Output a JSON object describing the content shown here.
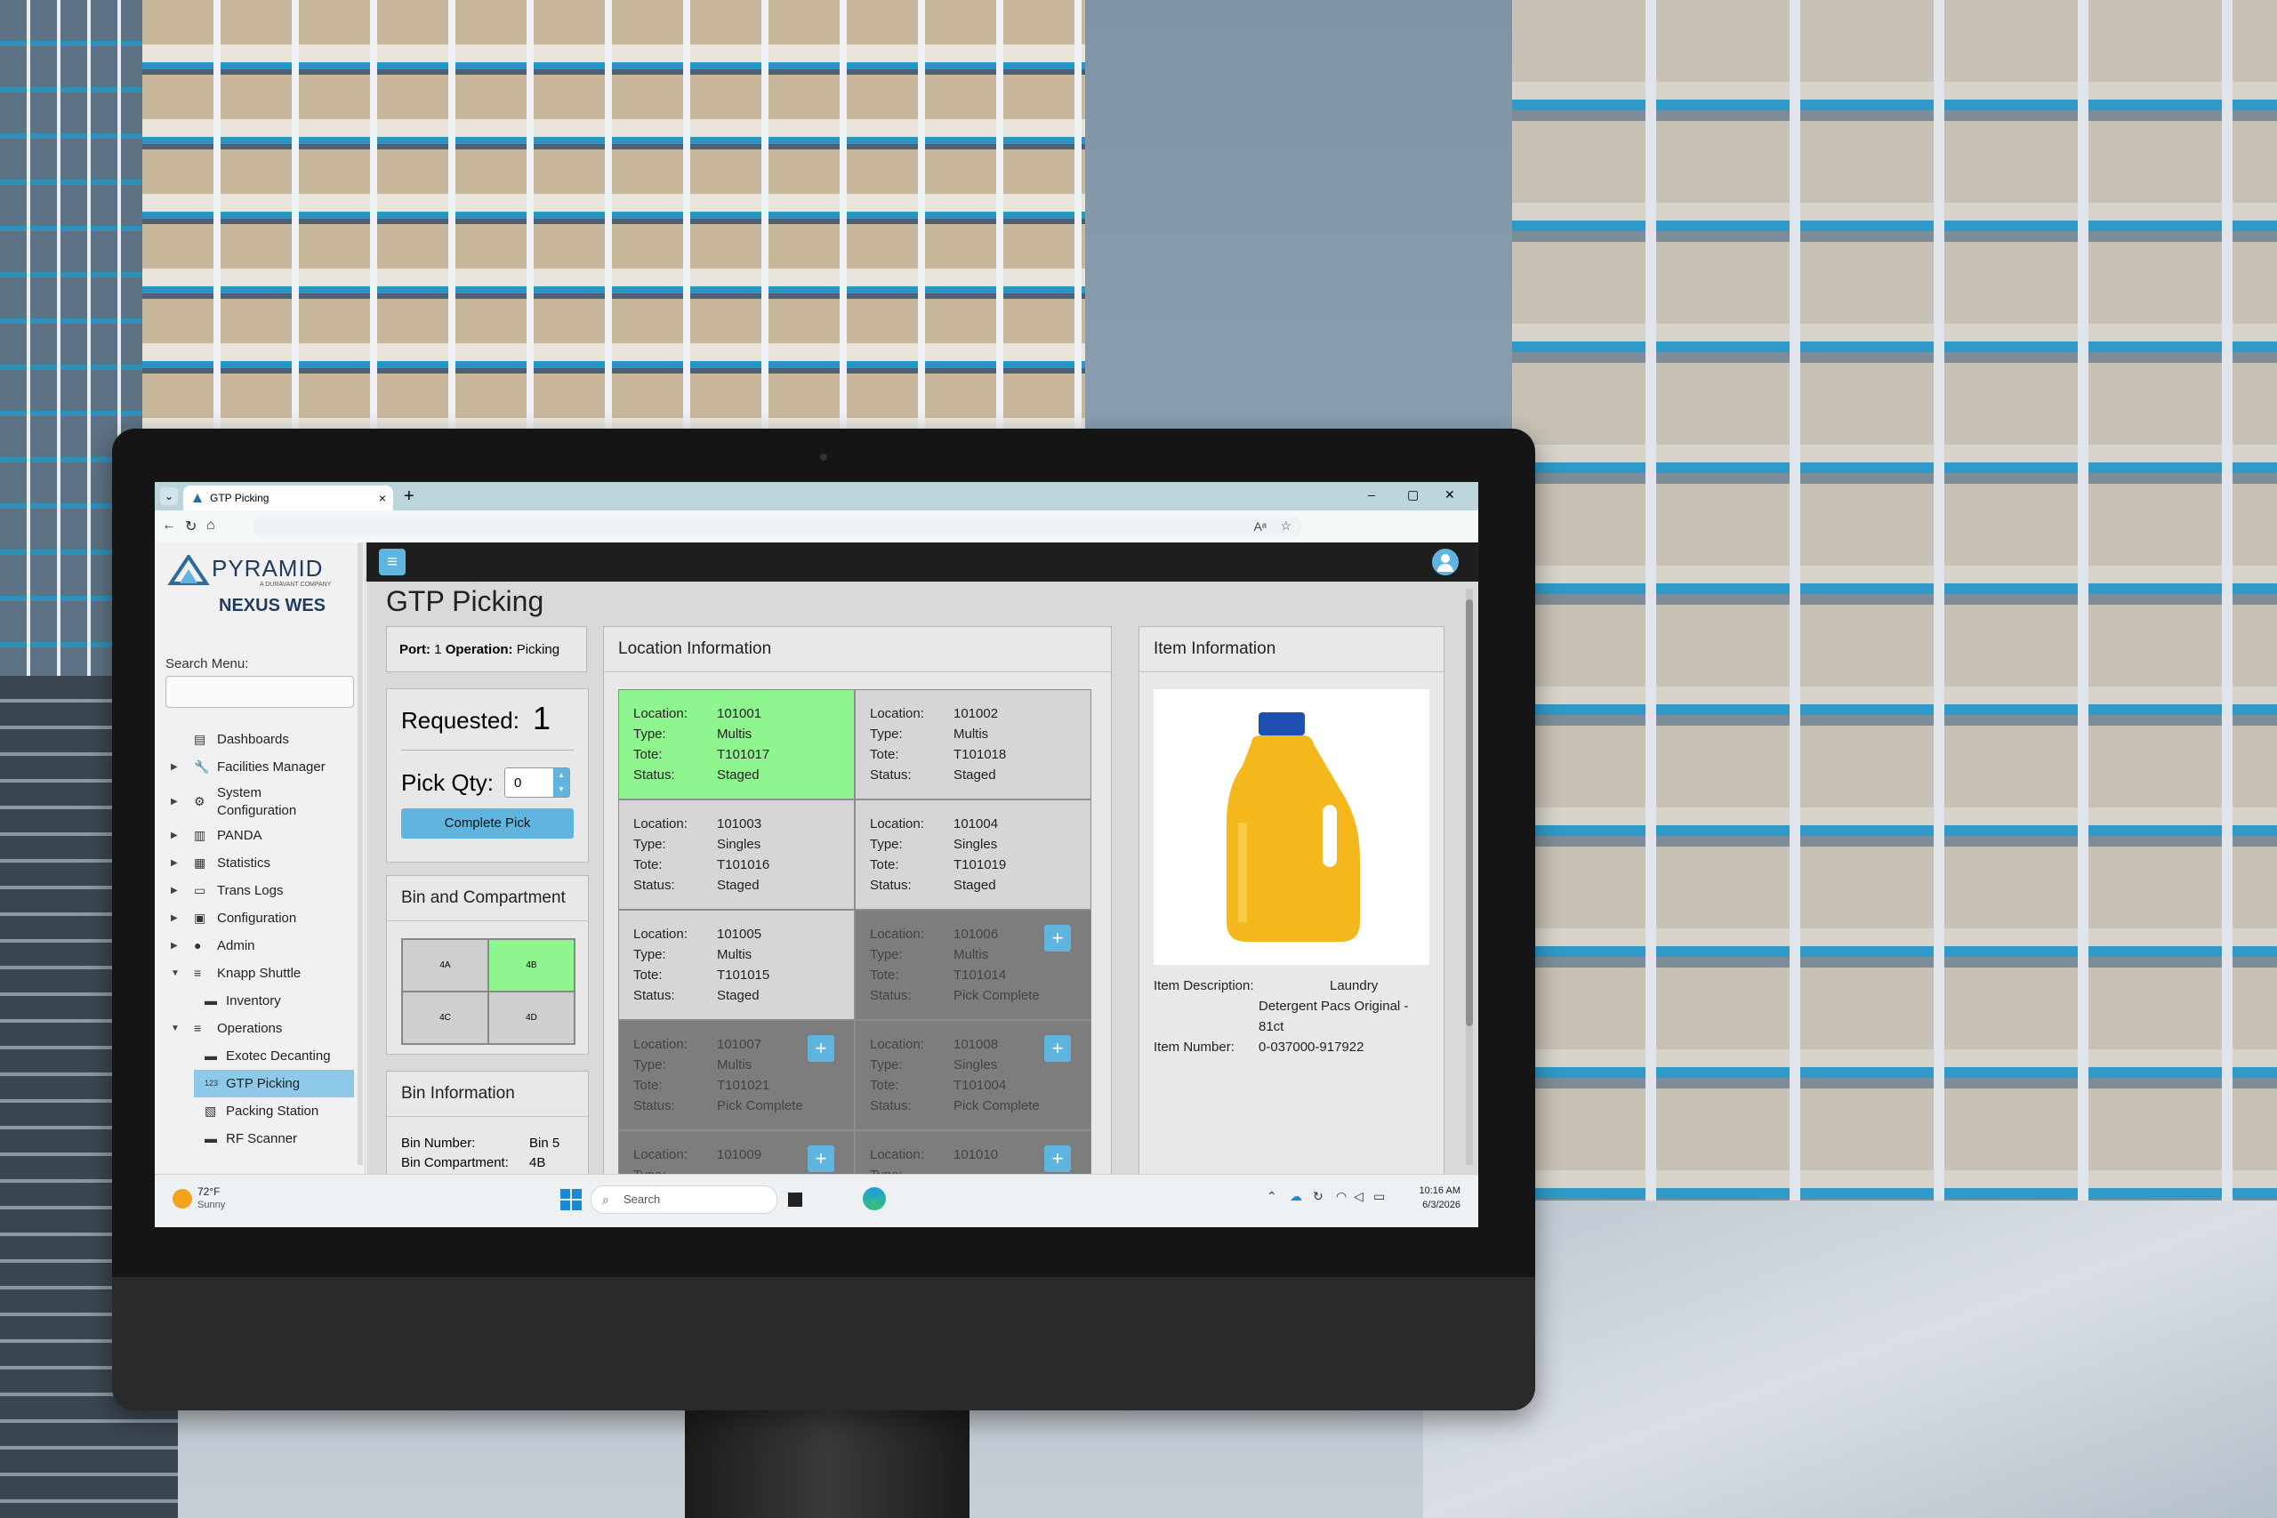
{
  "browser": {
    "tab_title": "GTP Picking",
    "tab_close": "×",
    "new_tab": "+",
    "window_controls": [
      "–",
      "▢",
      "✕"
    ]
  },
  "sidebar": {
    "logo_name": "PYRAMID",
    "logo_sub": "A DURAVANT COMPANY",
    "product": "NEXUS WES",
    "search_label": "Search Menu:",
    "search_placeholder": "",
    "items": [
      {
        "label": "Dashboards",
        "icon": "dashboard-icon",
        "glyph": "▤"
      },
      {
        "label": "Facilities Manager",
        "icon": "wrench-icon",
        "glyph": "🔧"
      },
      {
        "label": "System Configuration",
        "icon": "gears-icon",
        "glyph": "⚙"
      },
      {
        "label": "PANDA",
        "icon": "building-icon",
        "glyph": "▥"
      },
      {
        "label": "Statistics",
        "icon": "chart-icon",
        "glyph": "▦"
      },
      {
        "label": "Trans Logs",
        "icon": "log-icon",
        "glyph": "▭"
      },
      {
        "label": "Configuration",
        "icon": "config-icon",
        "glyph": "▣"
      },
      {
        "label": "Admin",
        "icon": "user-icon",
        "glyph": "●"
      },
      {
        "label": "Knapp Shuttle",
        "icon": "list-icon",
        "glyph": "≡"
      },
      {
        "label": "Inventory",
        "icon": "inventory-icon",
        "glyph": "▬"
      },
      {
        "label": "Operations",
        "icon": "list-icon",
        "glyph": "≡"
      },
      {
        "label": "Exotec Decanting",
        "icon": "decant-icon",
        "glyph": "▬"
      },
      {
        "label": "GTP Picking",
        "icon": "numbers-icon",
        "glyph": "123"
      },
      {
        "label": "Packing Station",
        "icon": "package-icon",
        "glyph": "▧"
      },
      {
        "label": "RF Scanner",
        "icon": "scanner-icon",
        "glyph": "▬"
      }
    ]
  },
  "page": {
    "title": "GTP Picking",
    "port_label": "Port:",
    "port_value": "1",
    "operation_label": "Operation:",
    "operation_value": "Picking",
    "requested_label": "Requested:",
    "requested_value": "1",
    "pick_qty_label": "Pick Qty:",
    "pick_qty_value": "0",
    "complete_button": "Complete Pick",
    "bin_compartment_title": "Bin and Compartment",
    "compartments": [
      {
        "label": "4A",
        "active": false
      },
      {
        "label": "4B",
        "active": true
      },
      {
        "label": "4C",
        "active": false
      },
      {
        "label": "4D",
        "active": false
      }
    ],
    "bin_info_title": "Bin Information",
    "bin_number_label": "Bin Number:",
    "bin_number_value": "Bin 5",
    "bin_compartment_label": "Bin Compartment:",
    "bin_compartment_value": "4B"
  },
  "location_info": {
    "title": "Location Information",
    "field_labels": [
      "Location:",
      "Type:",
      "Tote:",
      "Status:"
    ],
    "locations": [
      {
        "location": "101001",
        "type": "Multis",
        "tote": "T101017",
        "status": "Staged",
        "state": "green"
      },
      {
        "location": "101002",
        "type": "Multis",
        "tote": "T101018",
        "status": "Staged",
        "state": "staged"
      },
      {
        "location": "101003",
        "type": "Singles",
        "tote": "T101016",
        "status": "Staged",
        "state": "staged"
      },
      {
        "location": "101004",
        "type": "Singles",
        "tote": "T101019",
        "status": "Staged",
        "state": "staged"
      },
      {
        "location": "101005",
        "type": "Multis",
        "tote": "T101015",
        "status": "Staged",
        "state": "staged"
      },
      {
        "location": "101006",
        "type": "Multis",
        "tote": "T101014",
        "status": "Pick Complete",
        "state": "done"
      },
      {
        "location": "101007",
        "type": "Multis",
        "tote": "T101021",
        "status": "Pick Complete",
        "state": "done"
      },
      {
        "location": "101008",
        "type": "Singles",
        "tote": "T101004",
        "status": "Pick Complete",
        "state": "done"
      },
      {
        "location": "101009",
        "type": "",
        "tote": "",
        "status": "",
        "state": "done"
      },
      {
        "location": "101010",
        "type": "",
        "tote": "",
        "status": "",
        "state": "done"
      }
    ]
  },
  "item_info": {
    "title": "Item Information",
    "description_label": "Item Description:",
    "description_value": "Laundry Detergent Pacs Original - 81ct",
    "number_label": "Item Number:",
    "number_value": "0-037000-917922"
  },
  "taskbar": {
    "temperature": "72°F",
    "weather": "Sunny",
    "search": "Search",
    "time": "10:16 AM",
    "date": "6/3/2026"
  },
  "colors": {
    "accent": "#5fb4e0",
    "highlight_green": "#8ff58f",
    "complete_gray": "#7d7d7d"
  }
}
